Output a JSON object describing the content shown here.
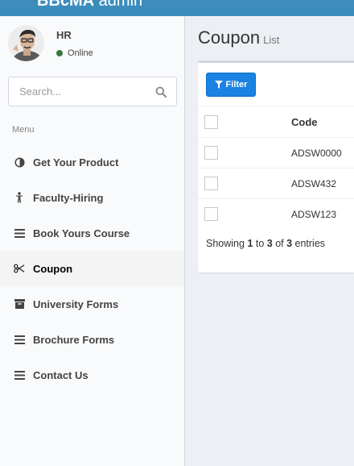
{
  "header": {
    "brand_bold": "BBcMA",
    "brand_light": " admin"
  },
  "user": {
    "name": "HR",
    "status": "Online"
  },
  "search": {
    "placeholder": "Search..."
  },
  "sidebar": {
    "menu_header": "Menu",
    "items": [
      {
        "label": "Get Your Product",
        "icon": "adjust-icon"
      },
      {
        "label": "Faculty-Hiring",
        "icon": "person-icon"
      },
      {
        "label": "Book Yours Course",
        "icon": "bars-icon"
      },
      {
        "label": "Coupon",
        "icon": "scissors-icon",
        "active": true
      },
      {
        "label": "University Forms",
        "icon": "archive-icon"
      },
      {
        "label": "Brochure Forms",
        "icon": "bars-icon"
      },
      {
        "label": "Contact Us",
        "icon": "bars-icon"
      }
    ]
  },
  "page": {
    "title": "Coupon",
    "subtitle": "List"
  },
  "toolbar": {
    "filter_label": "Filter"
  },
  "table": {
    "columns": [
      "",
      "Code"
    ],
    "rows": [
      {
        "code": "ADSW0000"
      },
      {
        "code": "ADSW432"
      },
      {
        "code": "ADSW123"
      }
    ]
  },
  "pagination": {
    "prefix": "Showing ",
    "from": "1",
    "to_word": " to ",
    "to": "3",
    "of_word": " of ",
    "total": "3",
    "suffix": " entries"
  },
  "colors": {
    "header": "#3c8dbc",
    "filter_button": "#1a82e2",
    "online": "#3c763d"
  }
}
